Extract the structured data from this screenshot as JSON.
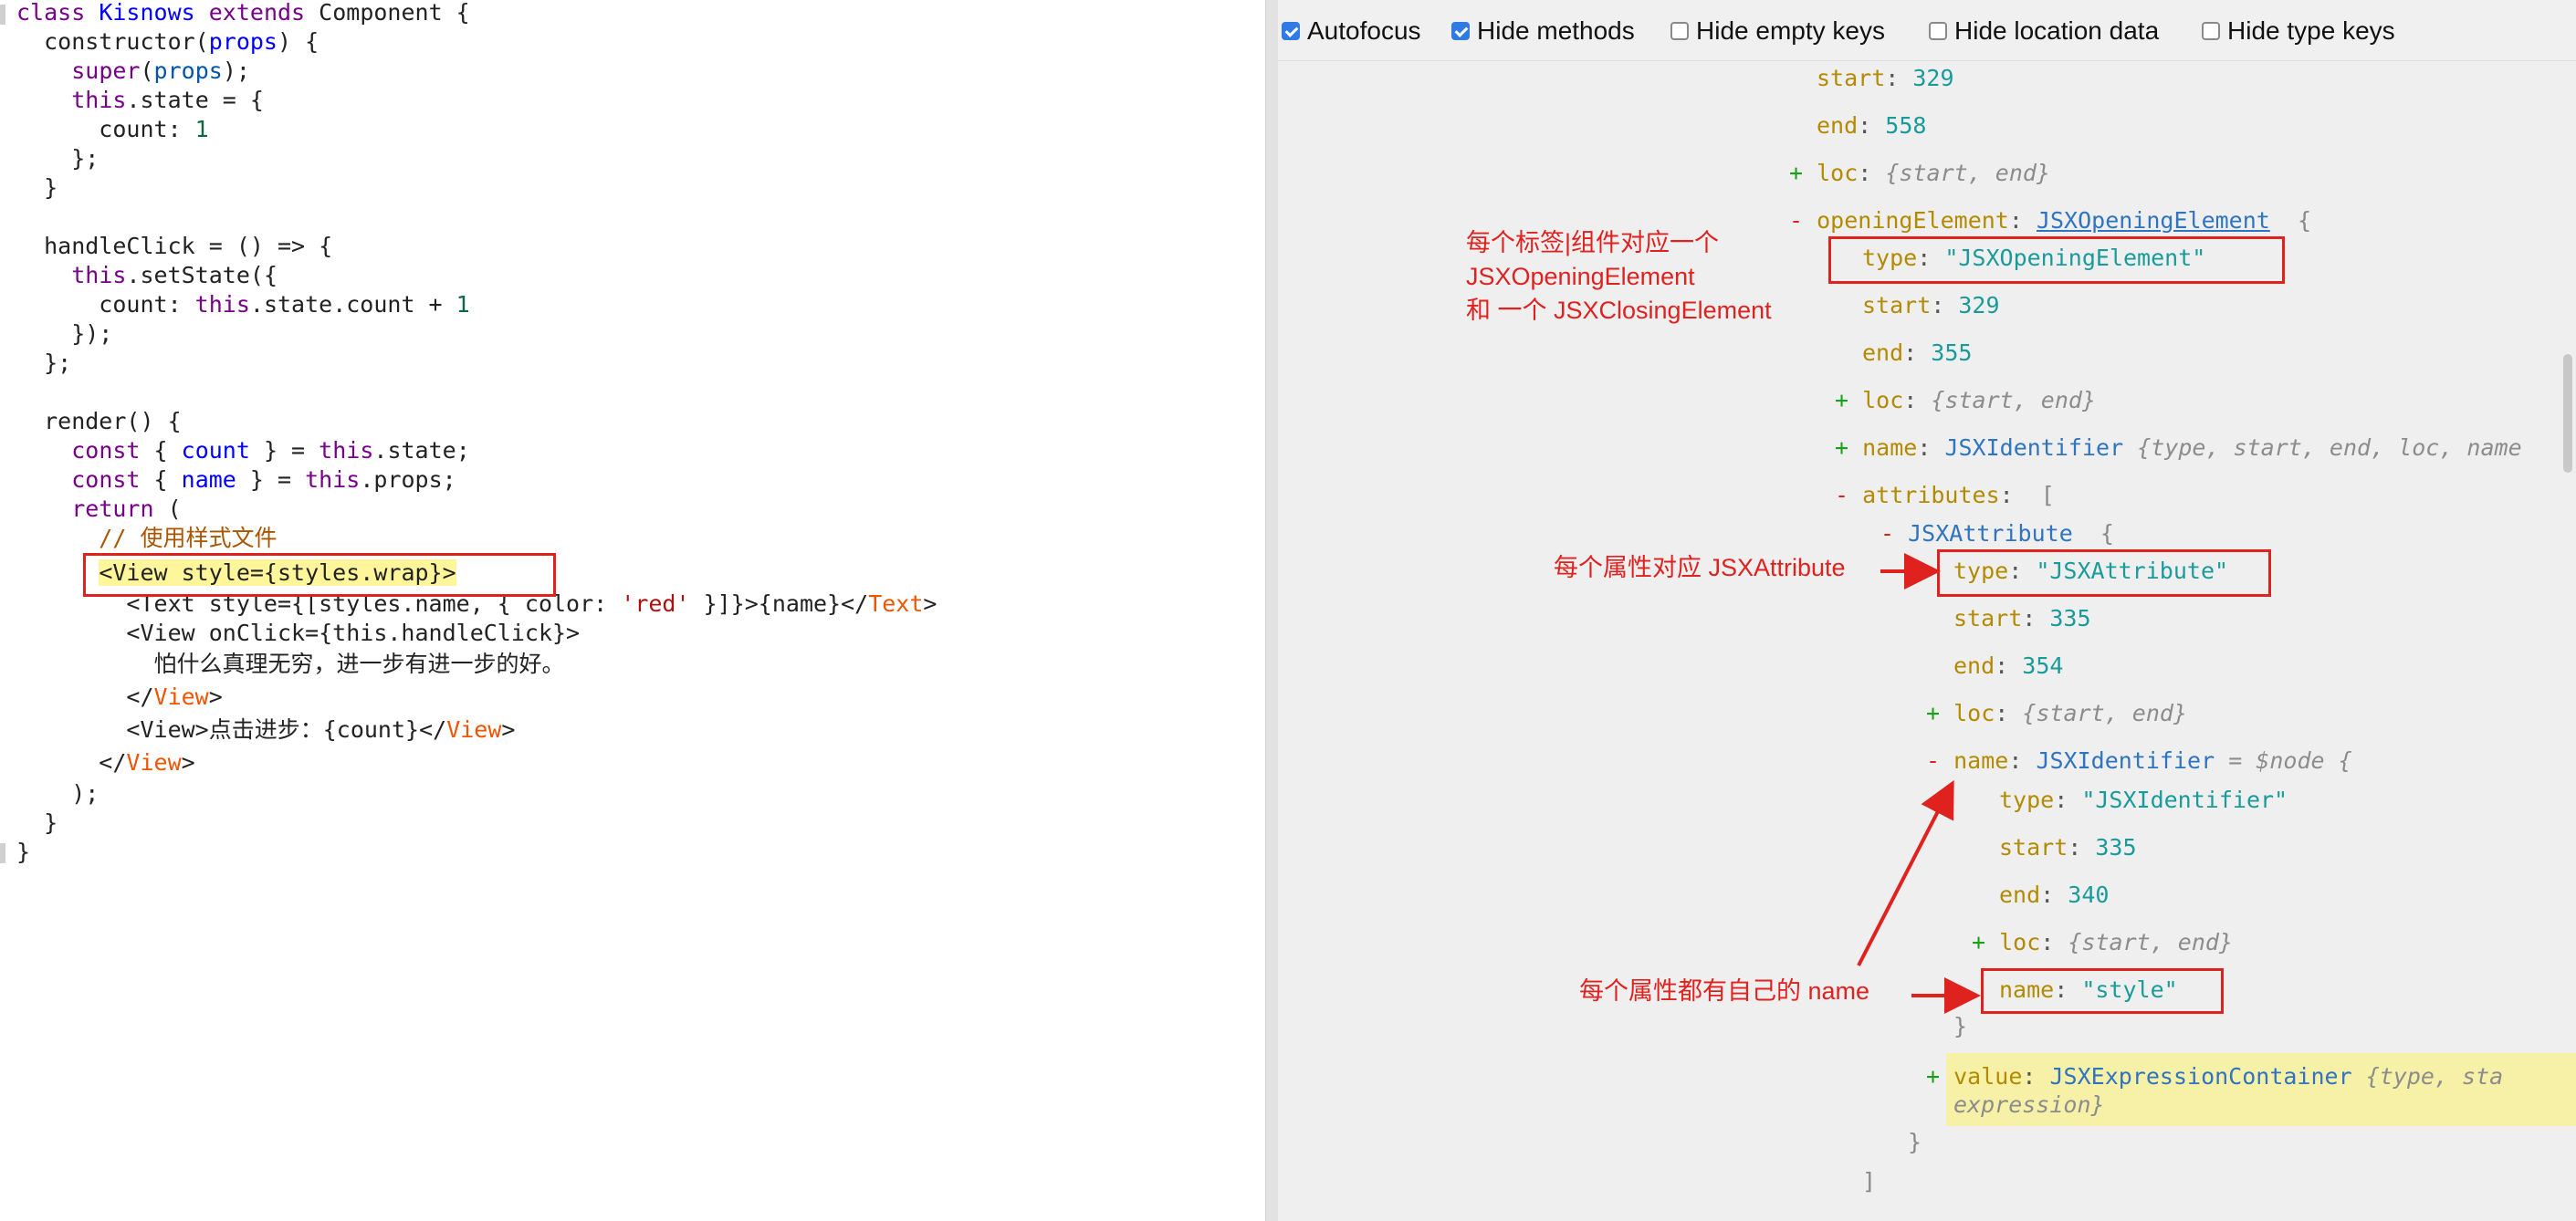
{
  "editor": {
    "code_lines": [
      "class Kisnows extends Component {",
      "  constructor(props) {",
      "    super(props);",
      "    this.state = {",
      "      count: 1",
      "    };",
      "  }",
      "",
      "  handleClick = () => {",
      "    this.setState({",
      "      count: this.state.count + 1",
      "    });",
      "  };",
      "",
      "  render() {",
      "    const { count } = this.state;",
      "    const { name } = this.props;",
      "    return (",
      "      // 使用样式文件",
      "      <View style={styles.wrap}>",
      "        <Text style={[styles.name, { color: 'red' }]}>{name}</Text>",
      "        <View onClick={this.handleClick}>",
      "          怕什么真理无穷，进一步有进一步的好。",
      "        </View>",
      "        <View>点击进步：{count}</View>",
      "      </View>",
      "    );",
      "  }",
      "}"
    ]
  },
  "toolbar": {
    "options": [
      {
        "label": "Autofocus",
        "checked": true
      },
      {
        "label": "Hide methods",
        "checked": true
      },
      {
        "label": "Hide empty keys",
        "checked": false
      },
      {
        "label": "Hide location data",
        "checked": false
      },
      {
        "label": "Hide type keys",
        "checked": false
      }
    ]
  },
  "ast": {
    "start_329": "329",
    "end_558": "558",
    "loc_collapsed": "{start, end}",
    "openingElement_key": "openingElement",
    "openingElement_type": "JSXOpeningElement",
    "type_key": "type",
    "type_opening_value": "\"JSXOpeningElement\"",
    "start_key": "start",
    "end_key": "end",
    "loc_key": "loc",
    "name_key": "name",
    "attributes_key": "attributes",
    "oe_start": "329",
    "oe_end": "355",
    "name_type": "JSXIdentifier",
    "name_summary": "{type, start, end, loc, name",
    "attr_node": "JSXAttribute",
    "type_attr_value": "\"JSXAttribute\"",
    "attr_start": "335",
    "attr_end": "354",
    "node_ref": "= $node {",
    "type_ident_value": "\"JSXIdentifier\"",
    "ident_start": "335",
    "ident_end": "340",
    "name_value": "\"style\"",
    "value_key": "value",
    "value_type": "JSXExpressionContainer",
    "value_summary_1": "{type, sta",
    "value_summary_2": "expression}"
  },
  "annotations": {
    "opening_element_note_line1": "每个标签|组件对应一个",
    "opening_element_note_line2": "JSXOpeningElement",
    "opening_element_note_line3": "和 一个 JSXClosingElement",
    "attribute_note": "每个属性对应 JSXAttribute",
    "name_note": "每个属性都有自己的 name"
  },
  "colors": {
    "annotation_red": "#e0221f",
    "checkbox_blue": "#2f7ae5",
    "highlight_yellow": "#fff59a"
  }
}
